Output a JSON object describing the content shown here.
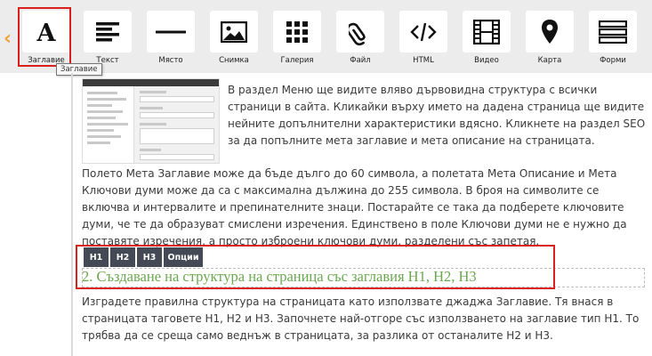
{
  "toolbar": {
    "tools": [
      {
        "label": "Заглавие",
        "icon": "heading-a-icon"
      },
      {
        "label": "Текст",
        "icon": "text-align-icon"
      },
      {
        "label": "Място",
        "icon": "spacer-line-icon"
      },
      {
        "label": "Снимка",
        "icon": "image-icon"
      },
      {
        "label": "Галерия",
        "icon": "gallery-grid-icon"
      },
      {
        "label": "Файл",
        "icon": "paperclip-icon"
      },
      {
        "label": "HTML",
        "icon": "code-icon"
      },
      {
        "label": "Видео",
        "icon": "film-icon"
      },
      {
        "label": "Карта",
        "icon": "map-pin-icon"
      },
      {
        "label": "Форми",
        "icon": "form-icon"
      }
    ],
    "tooltip": "Заглавие"
  },
  "content": {
    "paragraph_1": "В раздел Меню ще видите вляво дървовидна структура с всички страници в сайта. Кликайки върху името на дадена страница ще видите нейните допълнителни характеристики вдясно. Кликнете на раздел SEO за да попълните мета заглавие и мета описание на страницата.",
    "paragraph_2": "Полето Мета Заглавие може да бъде дълго до 60 символа, а полетата Мета Описание и Мета Ключови думи може да са с максимална дължина до 255 символа. В броя на символите се включва и интервалите и препинателните знаци. Постарайте се така да подберете ключовите думи, че те да образуват смислени изречения. Единствено в поле Ключови думи не е нужно да поставяте изречения, а просто изброени ключови думи, разделени със запетая.",
    "heading_buttons": [
      "H1",
      "H2",
      "H3",
      "Опции"
    ],
    "heading_text": "2. Създаване на структура на страница със заглавия Н1, Н2, Н3",
    "paragraph_3": "Изградете правилна структура на страницата като използвате джаджа Заглавие. Тя внася в страницата таговете Н1, Н2 и Н3. Започнете най-отгоре със използването на заглавие тип Н1. То трябва да се среща само веднъж в страницата, за разлика от останалите Н2 и Н3."
  },
  "colors": {
    "highlight": "#d9201c",
    "heading_green": "#6aa84f",
    "accent_orange": "#f0a23b",
    "button_dark": "#444a55"
  }
}
